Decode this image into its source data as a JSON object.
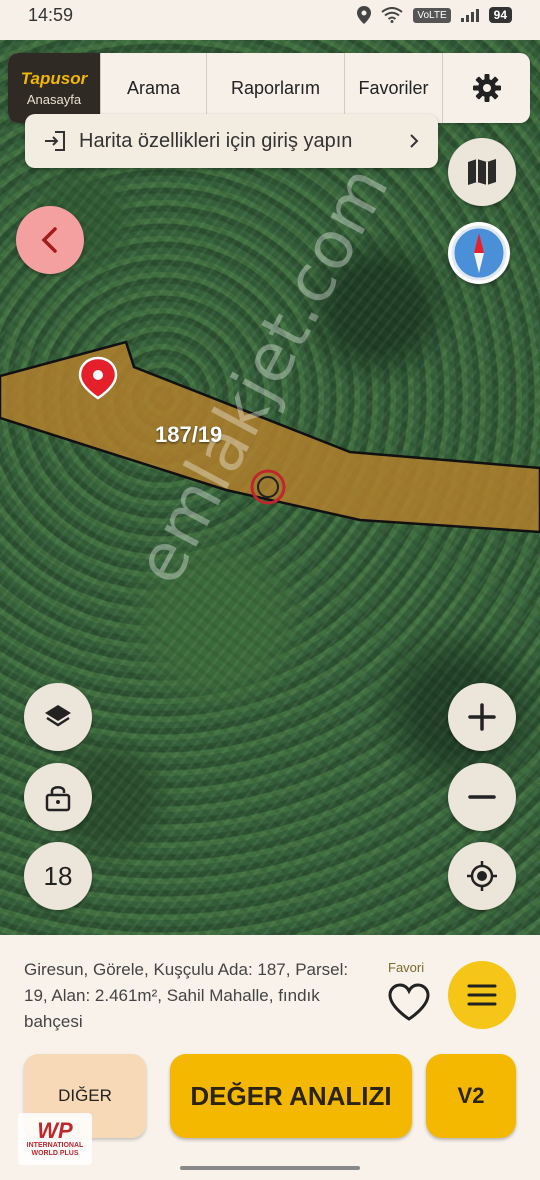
{
  "status": {
    "time": "14:59",
    "volte": "VoLTE",
    "battery": "94"
  },
  "nav": {
    "logo_title": "Tapusor",
    "logo_sub": "Anasayfa",
    "search": "Arama",
    "reports": "Raporlarım",
    "favorites": "Favoriler"
  },
  "login_banner": {
    "text": "Harita özellikleri için giriş yapın"
  },
  "map": {
    "parcel_label": "187/19",
    "watermark": "emlakjet.com",
    "zoom_level": "18"
  },
  "panel": {
    "info_text": "Giresun, Görele, Kuşçulu Ada: 187, Parsel: 19, Alan: 2.461m², Sahil Mahalle, fındık bahçesi",
    "favorite_label": "Favori",
    "other_button": "DIĞER",
    "value_analysis_button": "DEĞER ANALIZI",
    "v2_button": "V2"
  },
  "corner_logo": {
    "mark": "WP",
    "line1": "INTERNATIONAL",
    "line2": "WORLD PLUS"
  },
  "colors": {
    "accent": "#f5b800",
    "back_button": "#f5a0a0",
    "parcel_fill": "#b5802c",
    "marker": "#e5202b"
  },
  "icons": [
    "back-arrow-icon",
    "map-icon",
    "compass-icon",
    "layers-icon",
    "lock-icon",
    "plus-icon",
    "minus-icon",
    "locate-icon",
    "login-icon",
    "chevron-right-icon",
    "gear-icon",
    "heart-icon",
    "menu-icon",
    "location-pin-icon"
  ]
}
